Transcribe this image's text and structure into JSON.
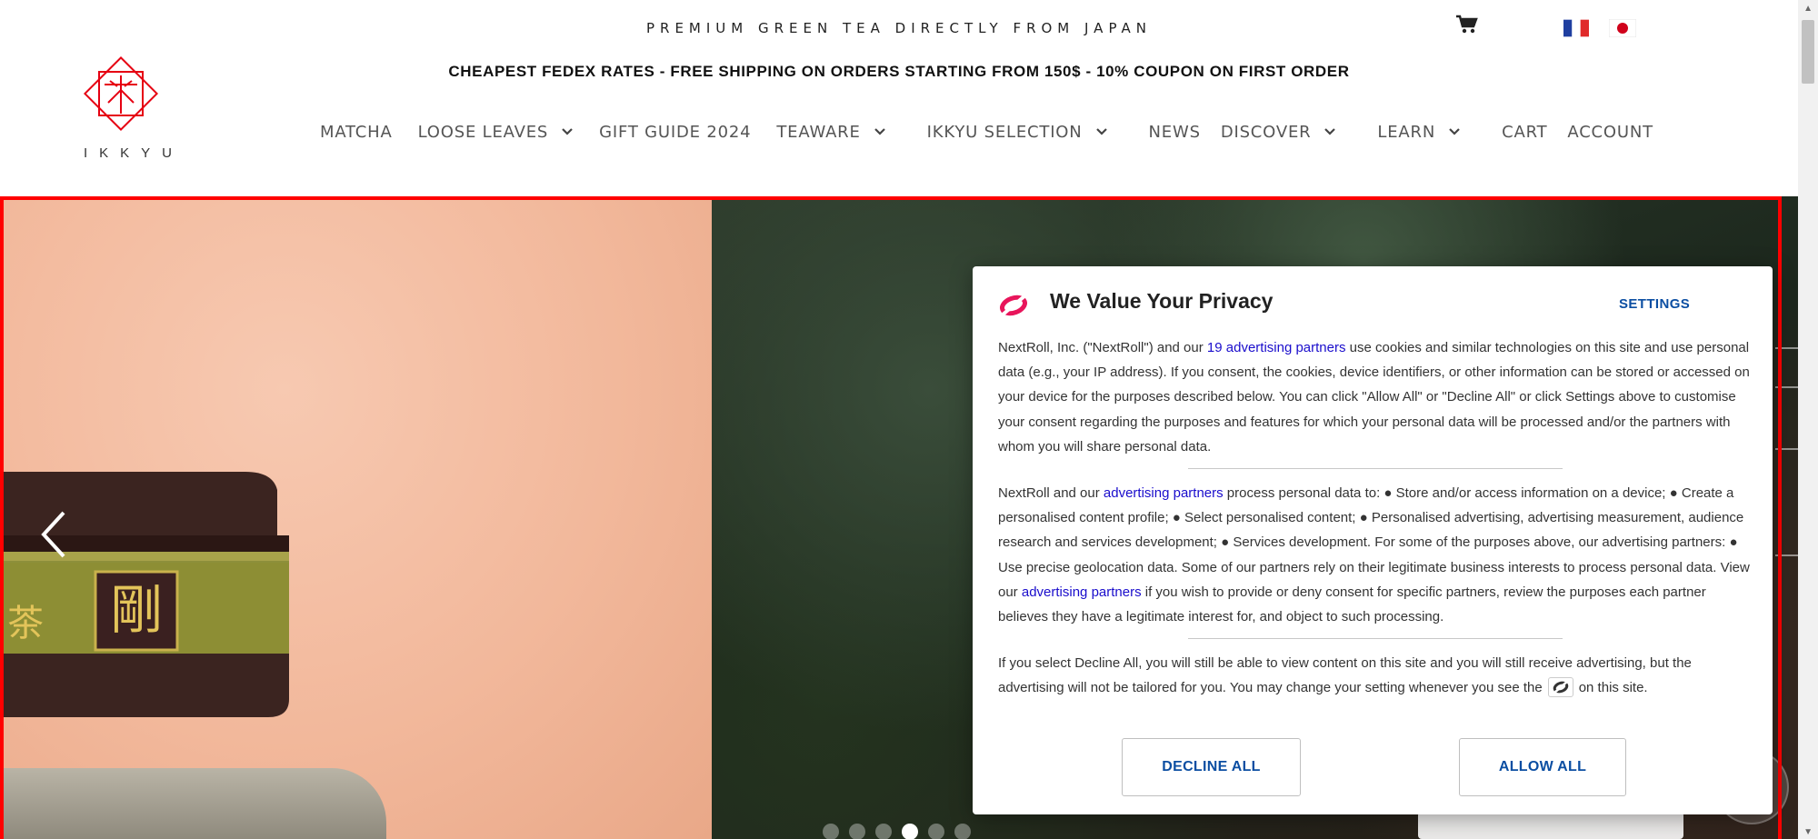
{
  "header": {
    "tagline": "PREMIUM GREEN TEA DIRECTLY FROM JAPAN",
    "promo": "CHEAPEST FEDEX RATES - FREE SHIPPING ON ORDERS STARTING FROM 150$ - 10% COUPON ON FIRST ORDER",
    "logo_text": "IKKYU",
    "icons": [
      "cart-icon",
      "flag-france-icon",
      "flag-japan-icon"
    ]
  },
  "nav": {
    "items": [
      {
        "label": "MATCHA",
        "dropdown": false
      },
      {
        "label": "LOOSE LEAVES",
        "dropdown": true
      },
      {
        "label": "GIFT GUIDE 2024",
        "dropdown": false
      },
      {
        "label": "TEAWARE",
        "dropdown": true
      },
      {
        "label": "IKKYU SELECTION",
        "dropdown": true
      },
      {
        "label": "NEWS",
        "dropdown": false
      },
      {
        "label": "DISCOVER",
        "dropdown": true
      },
      {
        "label": "LEARN",
        "dropdown": true
      },
      {
        "label": "CART",
        "dropdown": false
      },
      {
        "label": "ACCOUNT",
        "dropdown": false
      }
    ]
  },
  "carousel": {
    "slide_count": 6,
    "active_index": 3
  },
  "privacy": {
    "title": "We Value Your Privacy",
    "settings_label": "SETTINGS",
    "p1_a": "NextRoll, Inc. (\"NextRoll\") and our ",
    "p1_link": "19 advertising partners",
    "p1_b": " use cookies and similar technologies on this site and use personal data (e.g., your IP address). If you consent, the cookies, device identifiers, or other information can be stored or accessed on your device for the purposes described below. You can click \"Allow All\" or \"Decline All\" or click Settings above to customise your consent regarding the purposes and features for which your personal data will be processed and/or the partners with whom you will share personal data.",
    "p2_a": "NextRoll and our ",
    "p2_link1": "advertising partners",
    "p2_b": " process personal data to: ● Store and/or access information on a device; ● Create a personalised content profile; ● Select personalised content; ● Personalised advertising, advertising measurement, audience research and services development; ● Services development. For some of the purposes above, our advertising partners: ● Use precise geolocation data. Some of our partners rely on their legitimate business interests to process personal data. View our ",
    "p2_link2": "advertising partners",
    "p2_c": " if you wish to provide or deny consent for specific partners, review the purposes each partner believes they have a legitimate interest for, and object to such processing.",
    "p3_a": "If you select Decline All, you will still be able to view content on this site and you will still receive advertising, but the advertising will not be tailored for you. You may change your setting whenever you see the",
    "p3_b": "on this site.",
    "decline_label": "DECLINE ALL",
    "allow_label": "ALLOW ALL"
  },
  "colors": {
    "brand_red": "#e60012",
    "frame_red": "#ff0000",
    "link_blue": "#1a0dcc",
    "button_blue": "#0b4ea2",
    "nextroll_pink": "#e8155b"
  }
}
